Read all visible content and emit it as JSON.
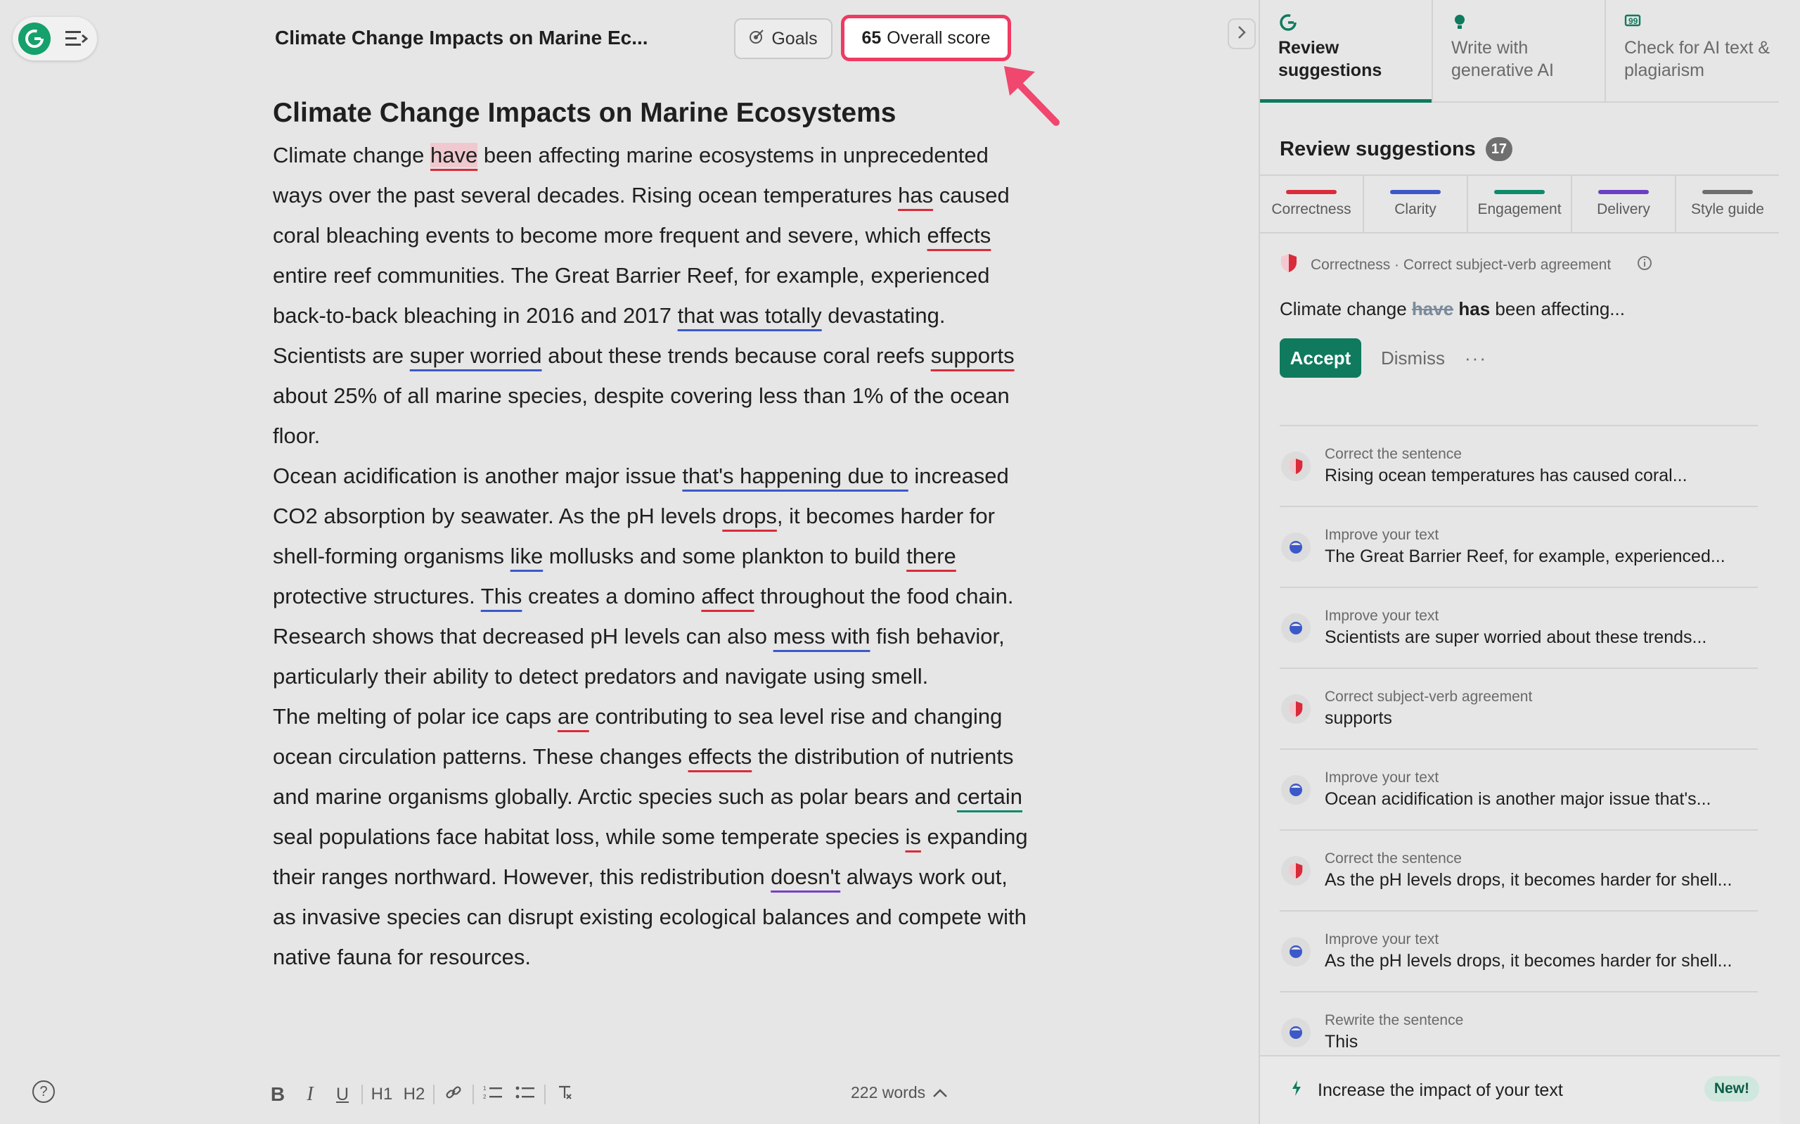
{
  "header": {
    "doc_title": "Climate Change Impacts on Marine Ec...",
    "goals_label": "Goals",
    "score_value": "65",
    "score_label": "Overall score"
  },
  "document": {
    "heading": "Climate Change Impacts on Marine Ecosystems",
    "p1": {
      "t1": "Climate change ",
      "e1": "have",
      "t2": " been affecting marine ecosystems in unprecedented ways over the past several decades. Rising ocean temperatures ",
      "e2": "has",
      "t3": " caused coral bleaching events to become more frequent and severe, which ",
      "e3": "effects",
      "t4": " entire reef communities. The Great Barrier Reef, for example, experienced back-to-back bleaching in 2016 and 2017 ",
      "e4": "that was totally",
      "t5": " devastating. Scientists are ",
      "e5": "super worried",
      "t6": " about these trends because coral reefs ",
      "e6": "supports",
      "t7": " about 25% of all marine species, despite covering less than 1% of the ocean floor."
    },
    "p2": {
      "t1": "Ocean acidification is another major issue ",
      "e1": "that's happening due to",
      "t2": " increased CO2 absorption by seawater. As the pH levels ",
      "e2": "drops",
      "t3": ", it becomes harder for shell-forming organisms ",
      "e3": "like",
      "t4": " mollusks and some plankton to build ",
      "e4": "there",
      "t5": " protective structures. ",
      "e5": "This",
      "t6": " creates a domino ",
      "e6": "affect",
      "t7": " throughout the food chain. Research shows that decreased pH levels can also ",
      "e7": "mess with",
      "t8": " fish behavior, particularly their ability to detect predators and navigate using smell."
    },
    "p3": {
      "t1": "The melting of polar ice caps ",
      "e1": "are",
      "t2": " contributing to sea level rise and changing ocean circulation patterns. These changes ",
      "e2": "effects",
      "t3": " the distribution of nutrients and marine organisms globally. Arctic species such as polar bears and ",
      "e3": "certain",
      "t4": " seal populations face habitat loss, while some temperate species ",
      "e4": "is",
      "t5": " expanding their ranges northward. However, this redistribution ",
      "e5": "doesn't",
      "t6": " always work out, as invasive species can disrupt existing ecological balances and compete with native fauna for resources."
    }
  },
  "toolbar": {
    "bold": "B",
    "italic": "I",
    "underline": "U",
    "h1": "H1",
    "h2": "H2",
    "word_count": "222 words"
  },
  "panel": {
    "tabs": [
      {
        "label": "Review suggestions"
      },
      {
        "label": "Write with generative AI"
      },
      {
        "label": "Check for AI text & plagiarism"
      }
    ],
    "title": "Review suggestions",
    "count": "17",
    "categories": [
      {
        "label": "Correctness",
        "color": "#d92b3a"
      },
      {
        "label": "Clarity",
        "color": "#3c58c9"
      },
      {
        "label": "Engagement",
        "color": "#0f8a6a"
      },
      {
        "label": "Delivery",
        "color": "#6a3fc4"
      },
      {
        "label": "Style guide",
        "color": "#6f6f6f"
      }
    ],
    "active_card": {
      "category": "Correctness · Correct subject-verb agreement",
      "prefix": "Climate change ",
      "removed": "have",
      "added": "has",
      "suffix": " been affecting...",
      "accept": "Accept",
      "dismiss": "Dismiss",
      "more": "···"
    },
    "suggestions": [
      {
        "label": "Correct the sentence",
        "text": "Rising ocean temperatures has caused coral...",
        "kind": "correctness"
      },
      {
        "label": "Improve your text",
        "text": "The Great Barrier Reef, for example, experienced...",
        "kind": "clarity"
      },
      {
        "label": "Improve your text",
        "text": "Scientists are super worried about these trends...",
        "kind": "clarity"
      },
      {
        "label": "Correct subject-verb agreement",
        "text": "supports",
        "kind": "correctness"
      },
      {
        "label": "Improve your text",
        "text": "Ocean acidification is another major issue that's...",
        "kind": "clarity"
      },
      {
        "label": "Correct the sentence",
        "text": "As the pH levels drops, it becomes harder for shell...",
        "kind": "correctness"
      },
      {
        "label": "Improve your text",
        "text": "As the pH levels drops, it becomes harder for shell...",
        "kind": "clarity"
      },
      {
        "label": "Rewrite the sentence",
        "text": "This",
        "kind": "clarity"
      }
    ],
    "bottom": {
      "label": "Increase the impact of your text",
      "badge": "New!"
    }
  },
  "colors": {
    "accent": "#0f7a5e",
    "score_border": "#ef3a62",
    "correctness": "#d92b3a",
    "clarity": "#3c58c9"
  }
}
